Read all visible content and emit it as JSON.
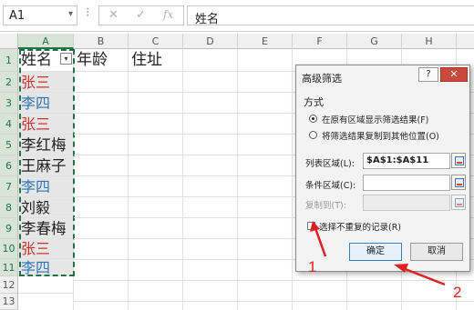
{
  "formula_bar": {
    "name_box": "A1",
    "cancel_icon": "✕",
    "enter_icon": "✓",
    "fx_label": "fx",
    "content": "姓名"
  },
  "columns": [
    "A",
    "B",
    "C",
    "D",
    "E",
    "F",
    "G",
    "H"
  ],
  "rows": [
    "1",
    "2",
    "3",
    "4",
    "5",
    "6",
    "7",
    "8",
    "9",
    "10",
    "11",
    "12",
    "13"
  ],
  "cells": {
    "A1": "姓名",
    "B1": "年龄",
    "C1": "住址",
    "column_A": [
      {
        "text": "张三",
        "color": "#d22f2f"
      },
      {
        "text": "李四",
        "color": "#2e74b5"
      },
      {
        "text": "张三",
        "color": "#d22f2f"
      },
      {
        "text": "李红梅",
        "color": "#222222"
      },
      {
        "text": "王麻子",
        "color": "#222222"
      },
      {
        "text": "李四",
        "color": "#2e74b5"
      },
      {
        "text": "刘毅",
        "color": "#222222"
      },
      {
        "text": "李春梅",
        "color": "#222222"
      },
      {
        "text": "张三",
        "color": "#d22f2f"
      },
      {
        "text": "李四",
        "color": "#2e74b5"
      }
    ]
  },
  "dialog": {
    "title": "高级筛选",
    "help_label": "?",
    "close_label": "✕",
    "section_label": "方式",
    "option_inplace": "在原有区域显示筛选结果(F)",
    "option_copy": "将筛选结果复制到其他位置(O)",
    "list_range_label": "列表区域(L):",
    "list_range_value": "$A$1:$A$11",
    "criteria_range_label": "条件区域(C):",
    "criteria_range_value": "",
    "copy_to_label": "复制到(T):",
    "copy_to_value": "",
    "unique_checkbox_label": "选择不重复的记录(R)",
    "ok_label": "确定",
    "cancel_label": "取消"
  },
  "annotations": {
    "marker_1": "1",
    "marker_2": "2",
    "color": "#e02020"
  }
}
